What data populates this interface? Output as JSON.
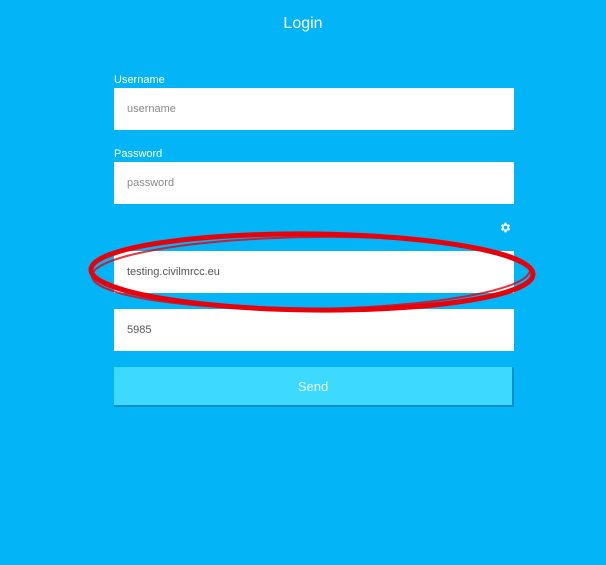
{
  "header": {
    "title": "Login"
  },
  "form": {
    "username_label": "Username",
    "username_placeholder": "username",
    "password_label": "Password",
    "password_placeholder": "password",
    "server_value": "testing.civilmrcc.eu",
    "port_value": "5985",
    "send_label": "Send"
  },
  "icons": {
    "settings": "gear-icon"
  },
  "colors": {
    "background": "#03b4f6",
    "button": "#3ed9fe",
    "annotation": "#e8000b"
  }
}
